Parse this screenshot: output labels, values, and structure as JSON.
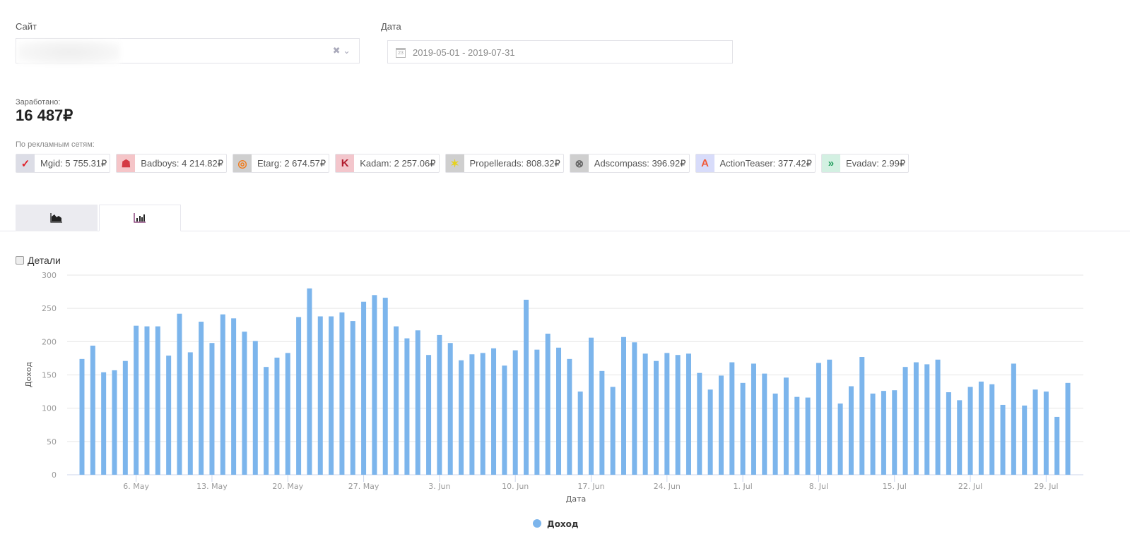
{
  "filters": {
    "site_label": "Сайт",
    "site_value": "",
    "date_label": "Дата",
    "date_value": "2019-05-01 - 2019-07-31"
  },
  "summary": {
    "earned_label": "Заработано:",
    "earned_value": "16 487₽",
    "networks_label": "По рекламным сетям:"
  },
  "networks": [
    {
      "name": "Mgid: ",
      "amount": "5 755.31₽",
      "icon": "mgid-icon",
      "bg": "#dcdde6",
      "fg": "#e0242c",
      "glyph": "✓"
    },
    {
      "name": "Badboys: ",
      "amount": "4 214.82₽",
      "icon": "badboys-icon",
      "bg": "#f5c5c8",
      "fg": "#d43a44",
      "glyph": "☗"
    },
    {
      "name": "Etarg: ",
      "amount": "2 674.57₽",
      "icon": "etarg-icon",
      "bg": "#cfcfcf",
      "fg": "#f07a1a",
      "glyph": "◎"
    },
    {
      "name": "Kadam: ",
      "amount": "2 257.06₽",
      "icon": "kadam-icon",
      "bg": "#f3c6cc",
      "fg": "#b01a2c",
      "glyph": "K"
    },
    {
      "name": "Propellerads: ",
      "amount": "808.32₽",
      "icon": "propellerads-icon",
      "bg": "#cfcfcf",
      "fg": "#e6d21a",
      "glyph": "✶"
    },
    {
      "name": "Adscompass: ",
      "amount": "396.92₽",
      "icon": "adscompass-icon",
      "bg": "#cfcfcf",
      "fg": "#666",
      "glyph": "⊗"
    },
    {
      "name": "ActionTeaser: ",
      "amount": "377.42₽",
      "icon": "actionteaser-icon",
      "bg": "#d8dcfa",
      "fg": "#f05a3a",
      "glyph": "A"
    },
    {
      "name": "Evadav: ",
      "amount": "2.99₽",
      "icon": "evadav-icon",
      "bg": "#d3f0e2",
      "fg": "#1e9c5a",
      "glyph": "»"
    }
  ],
  "details_label": "Детали",
  "chart_data": {
    "type": "bar",
    "xlabel": "Дата",
    "ylabel": "Доход",
    "ylim": [
      0,
      300
    ],
    "yticks": [
      0,
      50,
      100,
      150,
      200,
      250,
      300
    ],
    "legend": "Доход",
    "legend_position": "bottom",
    "color": "#7cb5ec",
    "start_date": "2019-05-01",
    "xtick_labels": [
      {
        "index": 5,
        "label": "6. May"
      },
      {
        "index": 12,
        "label": "13. May"
      },
      {
        "index": 19,
        "label": "20. May"
      },
      {
        "index": 26,
        "label": "27. May"
      },
      {
        "index": 33,
        "label": "3. Jun"
      },
      {
        "index": 40,
        "label": "10. Jun"
      },
      {
        "index": 47,
        "label": "17. Jun"
      },
      {
        "index": 54,
        "label": "24. Jun"
      },
      {
        "index": 61,
        "label": "1. Jul"
      },
      {
        "index": 68,
        "label": "8. Jul"
      },
      {
        "index": 75,
        "label": "15. Jul"
      },
      {
        "index": 82,
        "label": "22. Jul"
      },
      {
        "index": 89,
        "label": "29. Jul"
      }
    ],
    "values": [
      174,
      194,
      154,
      157,
      171,
      224,
      223,
      223,
      179,
      242,
      184,
      230,
      198,
      241,
      235,
      215,
      201,
      162,
      176,
      183,
      237,
      280,
      238,
      238,
      244,
      231,
      260,
      270,
      266,
      223,
      205,
      217,
      180,
      210,
      198,
      172,
      181,
      183,
      190,
      164,
      187,
      263,
      188,
      212,
      191,
      174,
      125,
      206,
      156,
      132,
      207,
      199,
      182,
      171,
      183,
      180,
      182,
      153,
      128,
      149,
      169,
      138,
      167,
      152,
      122,
      146,
      117,
      116,
      168,
      173,
      107,
      133,
      177,
      122,
      126,
      127,
      162,
      169,
      166,
      173,
      124,
      112,
      132,
      140,
      136,
      105,
      167,
      104,
      128,
      125,
      87,
      138
    ]
  }
}
